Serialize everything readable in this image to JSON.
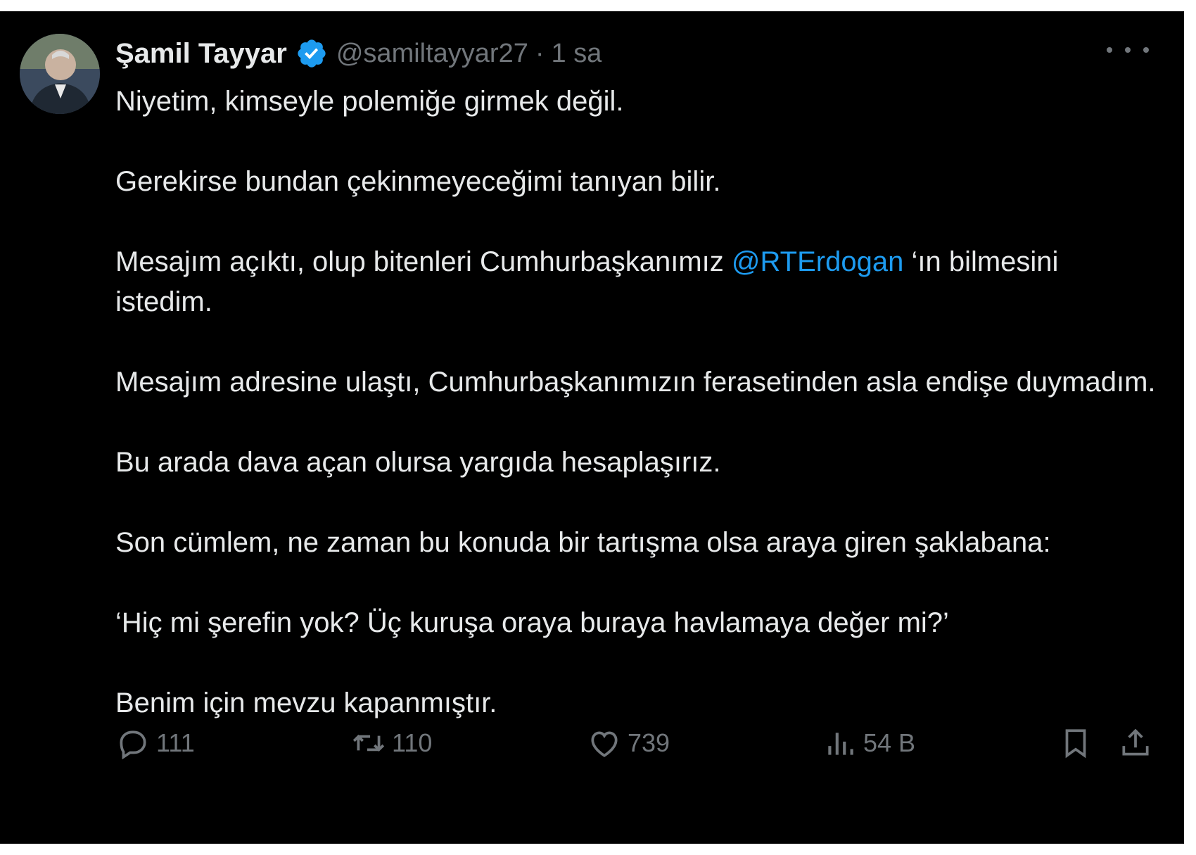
{
  "tweet": {
    "author": {
      "name": "Şamil Tayyar",
      "handle": "@samiltayyar27",
      "separator": "·",
      "time": "1 sa"
    },
    "paragraphs": [
      "Niyetim, kimseyle polemiğe girmek değil.",
      "Gerekirse bundan çekinmeyeceğimi tanıyan bilir.",
      "Mesajım adresine ulaştı, Cumhurbaşkanımızın ferasetinden asla endişe duymadım.",
      "Bu arada dava açan olursa yargıda hesaplaşırız.",
      "Son cümlem, ne zaman bu konuda bir tartışma olsa araya giren şaklabana:",
      "‘Hiç mi şerefin yok? Üç kuruşa oraya buraya havlamaya değer mi?’",
      "Benim için mevzu kapanmıştır."
    ],
    "mention_paragraph": {
      "before": "Mesajım açıktı, olup bitenleri Cumhurbaşkanımız ",
      "mention": "@RTErdogan",
      "after": " ‘ın bilmesini istedim."
    },
    "stats": {
      "replies": "111",
      "reposts": "110",
      "likes": "739",
      "views": "54 B"
    }
  },
  "colors": {
    "background": "#000000",
    "text": "#e7e9ea",
    "secondary": "#71767b",
    "accent": "#1d9bf0"
  },
  "icons": [
    "verified-badge-icon",
    "more-icon",
    "reply-icon",
    "repost-icon",
    "like-icon",
    "views-icon",
    "bookmark-icon",
    "share-icon"
  ]
}
